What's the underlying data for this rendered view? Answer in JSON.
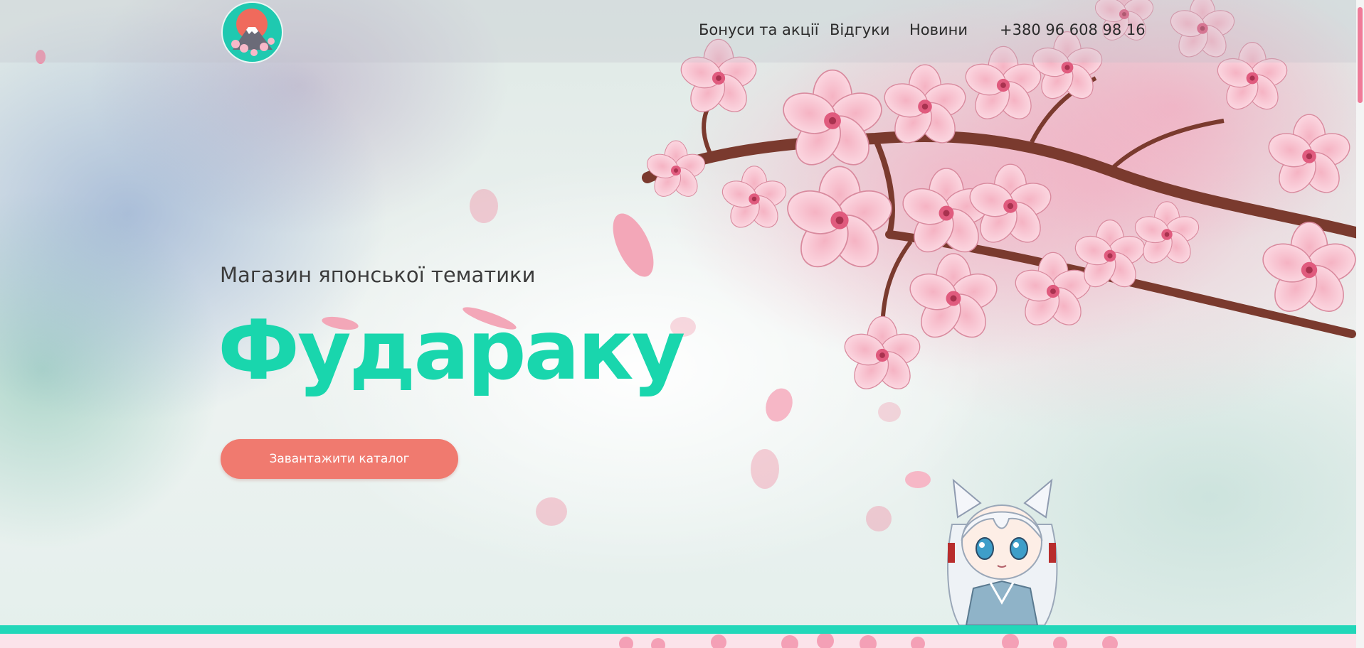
{
  "header": {
    "logo_icon": "mount-fuji-sakura-logo-icon",
    "nav": [
      {
        "label": "Бонуси та акції"
      },
      {
        "label": "Відгуки"
      },
      {
        "label": "Новини"
      },
      {
        "label": "+380 96 608 98 16"
      }
    ]
  },
  "hero": {
    "subtitle": "Магазин японської тематики",
    "title": "Фудараку",
    "cta_label": "Завантажити каталог"
  },
  "decor": {
    "background": "watercolor-sakura-branch",
    "mascot": "anime-catgirl-mascot"
  },
  "colors": {
    "accent_teal": "#19d6ad",
    "cta_coral": "#f07a6f",
    "strip_teal": "#22d7b9",
    "scroll_thumb": "#f07a98"
  }
}
